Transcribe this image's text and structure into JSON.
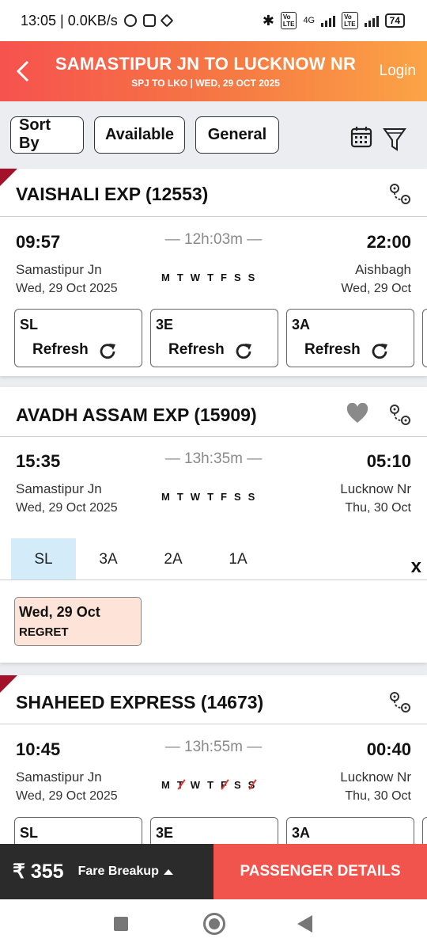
{
  "status_bar": {
    "time_speed": "13:05 | 0.0KB/s",
    "network": "4G",
    "battery": "74"
  },
  "header": {
    "title": "SAMASTIPUR JN TO LUCKNOW NR",
    "subtitle": "SPJ TO LKO | WED, 29 OCT  2025",
    "login": "Login"
  },
  "filters": {
    "sort_by": "Sort By",
    "available": "Available",
    "general": "General"
  },
  "trains": [
    {
      "name": "VAISHALI EXP",
      "number": "(12553)",
      "dep_time": "09:57",
      "arr_time": "22:00",
      "duration": "— 12h:03m —",
      "from_station": "Samastipur Jn",
      "to_station": "Aishbagh",
      "from_date": "Wed, 29 Oct  2025",
      "to_date": "Wed, 29 Oct",
      "classes": [
        {
          "code": "SL",
          "action": "Refresh"
        },
        {
          "code": "3E",
          "action": "Refresh"
        },
        {
          "code": "3A",
          "action": "Refresh"
        }
      ]
    },
    {
      "name": "AVADH ASSAM EXP",
      "number": "(15909)",
      "dep_time": "15:35",
      "arr_time": "05:10",
      "duration": "— 13h:35m —",
      "from_station": "Samastipur Jn",
      "to_station": "Lucknow Nr",
      "from_date": "Wed, 29 Oct  2025",
      "to_date": "Thu, 30 Oct",
      "tabs": [
        "SL",
        "3A",
        "2A",
        "1A"
      ],
      "close": "x",
      "availability": {
        "date": "Wed, 29 Oct",
        "status": "REGRET"
      }
    },
    {
      "name": "SHAHEED EXPRESS",
      "number": "(14673)",
      "dep_time": "10:45",
      "arr_time": "00:40",
      "duration": "— 13h:55m —",
      "from_station": "Samastipur Jn",
      "to_station": "Lucknow Nr",
      "from_date": "Wed, 29 Oct  2025",
      "to_date": "Thu, 30 Oct",
      "classes": [
        {
          "code": "SL"
        },
        {
          "code": "3E"
        },
        {
          "code": "3A"
        }
      ]
    }
  ],
  "days": [
    "M",
    "T",
    "W",
    "T",
    "F",
    "S",
    "S"
  ],
  "footer": {
    "fare": "₹ 355",
    "fare_breakup": "Fare Breakup",
    "passenger_details": "PASSENGER DETAILS"
  },
  "colors": {
    "header_start": "#f6524e",
    "header_end": "#fba446",
    "accent_red": "#f0544c",
    "corner_ribbon": "#a3122a",
    "regret_bg": "#fde3d8",
    "active_tab": "#d4ecf9"
  }
}
